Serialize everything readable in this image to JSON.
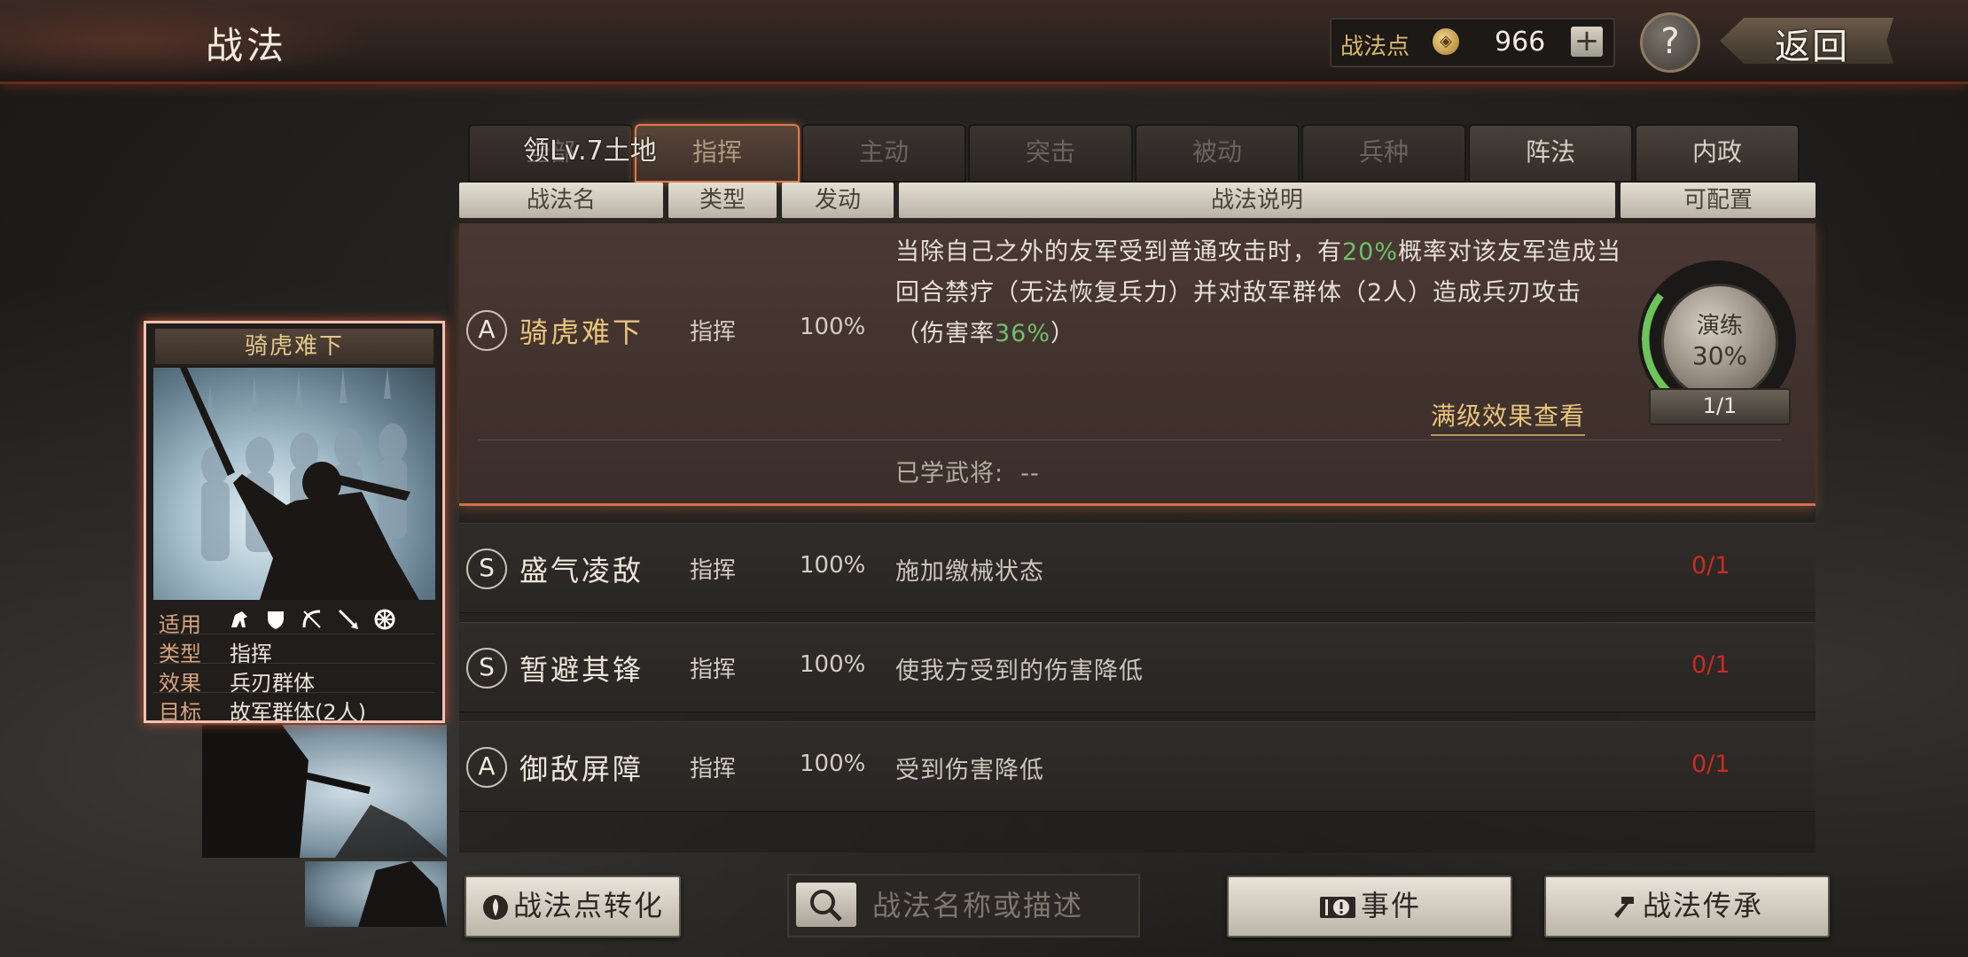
{
  "header": {
    "title": "战法",
    "points_label": "战法点",
    "points_value": "966",
    "plus": "+",
    "help": "?",
    "back": "返回"
  },
  "tabs": [
    {
      "label": "全部"
    },
    {
      "label": "指挥"
    },
    {
      "label": "主动"
    },
    {
      "label": "突击"
    },
    {
      "label": "被动"
    },
    {
      "label": "兵种"
    },
    {
      "label": "阵法"
    },
    {
      "label": "内政"
    }
  ],
  "tab_overlay": "领Lv.7土地",
  "columns": {
    "name": "战法名",
    "type": "类型",
    "trigger": "发动",
    "desc": "战法说明",
    "config": "可配置"
  },
  "selected": {
    "grade": "A",
    "name": "骑虎难下",
    "type": "指挥",
    "trigger": "100%",
    "desc_p1": "当除自己之外的友军受到普通攻击时，有",
    "desc_pct1": "20%",
    "desc_p2": "概率对该友军造成当回合禁疗（无法恢复兵力）并对敌军群体（2人）造成兵刃攻击（伤害率",
    "desc_pct2": "36%",
    "desc_p3": "）",
    "full_level_link": "满级效果查看",
    "learned_label": "已学武将:",
    "learned_value": "--",
    "practice_label": "演练",
    "practice_percent": "30%",
    "practice_progress": 0.3,
    "count": "1/1"
  },
  "rows": [
    {
      "grade": "S",
      "name": "盛气凌敌",
      "type": "指挥",
      "trigger": "100%",
      "desc": "施加缴械状态",
      "config": "0/1"
    },
    {
      "grade": "S",
      "name": "暂避其锋",
      "type": "指挥",
      "trigger": "100%",
      "desc": "使我方受到的伤害降低",
      "config": "0/1"
    },
    {
      "grade": "A",
      "name": "御敌屏障",
      "type": "指挥",
      "trigger": "100%",
      "desc": "受到伤害降低",
      "config": "0/1"
    }
  ],
  "card": {
    "title": "骑虎难下",
    "info": [
      {
        "k": "适用",
        "v": ""
      },
      {
        "k": "类型",
        "v": "指挥"
      },
      {
        "k": "效果",
        "v": "兵刃群体"
      },
      {
        "k": "目标",
        "v": "故军群体(2人)"
      }
    ],
    "unit_icons": [
      "cavalry-icon",
      "shield-icon",
      "bow-icon",
      "spear-icon",
      "wheel-icon"
    ]
  },
  "buttons": {
    "convert": "战法点转化",
    "search_placeholder": "战法名称或描述",
    "event": "事件",
    "inherit": "战法传承"
  }
}
